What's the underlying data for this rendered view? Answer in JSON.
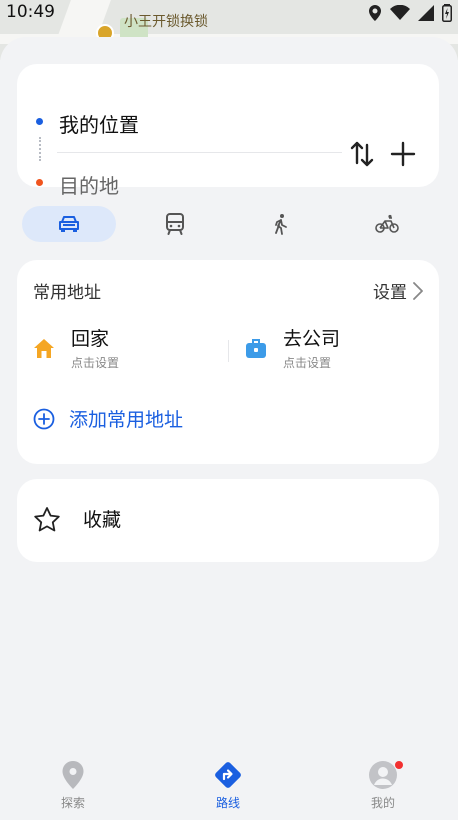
{
  "status_bar": {
    "time": "10:49"
  },
  "map": {
    "poi_label": "小王开锁换锁"
  },
  "route": {
    "from": "我的位置",
    "to": "目的地"
  },
  "transport_modes": [
    {
      "name": "car",
      "active": true
    },
    {
      "name": "transit",
      "active": false
    },
    {
      "name": "walk",
      "active": false
    },
    {
      "name": "bike",
      "active": false
    }
  ],
  "favorites": {
    "title": "常用地址",
    "settings_label": "设置",
    "home": {
      "label": "回家",
      "hint": "点击设置"
    },
    "work": {
      "label": "去公司",
      "hint": "点击设置"
    },
    "add_label": "添加常用地址"
  },
  "collections": {
    "label": "收藏"
  },
  "bottom_nav": [
    {
      "label": "探索",
      "icon": "location-pin-icon",
      "active": false
    },
    {
      "label": "路线",
      "icon": "route-icon",
      "active": true
    },
    {
      "label": "我的",
      "icon": "avatar-icon",
      "active": false,
      "badge": true
    }
  ],
  "colors": {
    "accent": "#1a5fe0",
    "origin_dot": "#1a5fe0",
    "destination_dot": "#f0541e",
    "home_icon": "#f5a623",
    "work_icon": "#3c9be8"
  }
}
